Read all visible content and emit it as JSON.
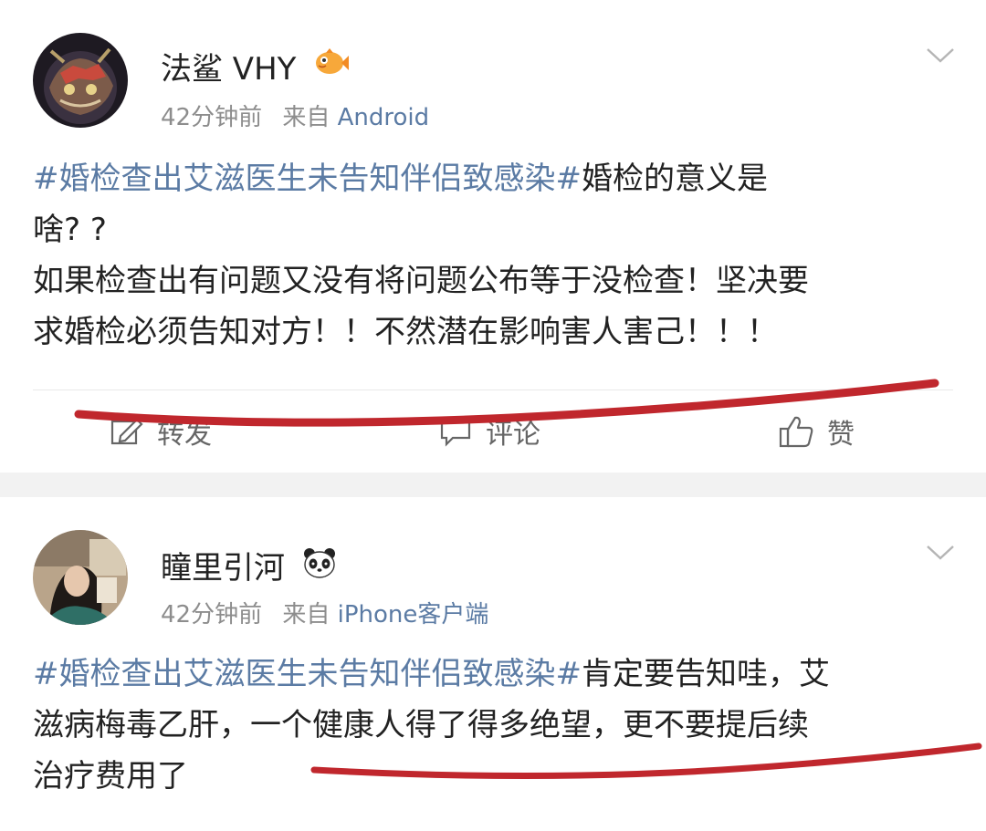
{
  "posts": [
    {
      "user_name": "法鲨 VHY",
      "time": "42分钟前",
      "via": "来自",
      "source": "Android",
      "lines": [
        {
          "tag": "#婚检查出艾滋医生未告知伴侣致感染#",
          "text": "婚检的意义是"
        },
        {
          "tag": "",
          "text": "啥? ?"
        },
        {
          "tag": "",
          "text": "如果检查出有问题又没有将问题公布等于没检查！坚决要"
        },
        {
          "tag": "",
          "text": "求婚检必须告知对方！！不然潜在影响害人害己！！！"
        }
      ],
      "actions": {
        "repost": "转发",
        "comment": "评论",
        "like": "赞"
      }
    },
    {
      "user_name": "瞳里引河",
      "time": "42分钟前",
      "via": "来自",
      "source": "iPhone客户端",
      "lines": [
        {
          "tag": "#婚检查出艾滋医生未告知伴侣致感染#",
          "text": "肯定要告知哇，艾"
        },
        {
          "tag": "",
          "text": "滋病梅毒乙肝，一个健康人得了得多绝望，更不要提后续"
        },
        {
          "tag": "",
          "text": "治疗费用了"
        }
      ]
    }
  ],
  "colors": {
    "link": "#5b7ba4",
    "meta": "#8d8d8d",
    "annotation": "#c0272d"
  },
  "icons": [
    "fish-emoji-icon",
    "panda-emoji-icon",
    "chevron-down-icon",
    "repost-icon",
    "comment-icon",
    "like-icon"
  ]
}
